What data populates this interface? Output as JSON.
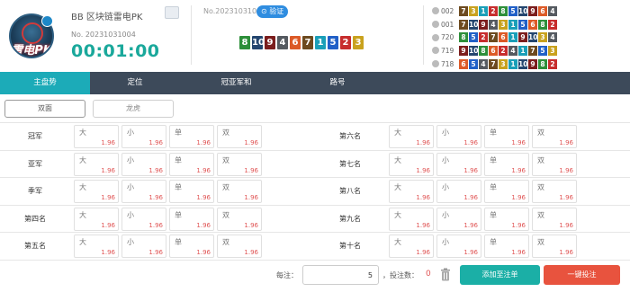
{
  "header": {
    "logo_text": "雷电PK",
    "game_title": "BB 区块链雷电PK",
    "current_issue": "No. 20231031004",
    "countdown": "00:01:00",
    "last_issue": "No.20231031003",
    "verify_label": "验证",
    "last_result": [
      {
        "n": "8",
        "c": "#2d8f3a"
      },
      {
        "n": "10",
        "c": "#24466f"
      },
      {
        "n": "9",
        "c": "#7b1d1d"
      },
      {
        "n": "4",
        "c": "#555a60"
      },
      {
        "n": "6",
        "c": "#dc5a27"
      },
      {
        "n": "7",
        "c": "#6d4a1f"
      },
      {
        "n": "1",
        "c": "#1a9fb8"
      },
      {
        "n": "5",
        "c": "#2160c7"
      },
      {
        "n": "2",
        "c": "#c72d2d"
      },
      {
        "n": "3",
        "c": "#c9a21e"
      }
    ]
  },
  "history": [
    {
      "no": "002",
      "balls": [
        "7",
        "3",
        "1",
        "2",
        "8",
        "5",
        "10",
        "9",
        "6",
        "4"
      ]
    },
    {
      "no": "001",
      "balls": [
        "7",
        "10",
        "9",
        "4",
        "3",
        "1",
        "5",
        "6",
        "8",
        "2"
      ]
    },
    {
      "no": "720",
      "balls": [
        "8",
        "5",
        "2",
        "7",
        "6",
        "1",
        "9",
        "10",
        "3",
        "4"
      ]
    },
    {
      "no": "719",
      "balls": [
        "9",
        "10",
        "8",
        "6",
        "2",
        "4",
        "1",
        "7",
        "5",
        "3"
      ]
    },
    {
      "no": "718",
      "balls": [
        "6",
        "5",
        "4",
        "7",
        "3",
        "1",
        "10",
        "9",
        "8",
        "2"
      ]
    }
  ],
  "ball_colors": {
    "1": "#1a9fb8",
    "2": "#c72d2d",
    "3": "#c9a21e",
    "4": "#555a60",
    "5": "#2160c7",
    "6": "#dc5a27",
    "7": "#6d4a1f",
    "8": "#2d8f3a",
    "9": "#7b1d1d",
    "10": "#24466f"
  },
  "tabs": [
    {
      "label": "主盘势",
      "active": true
    },
    {
      "label": "定位",
      "active": false
    },
    {
      "label": "冠亚军和",
      "active": false
    },
    {
      "label": "路号",
      "active": false
    }
  ],
  "subfilter": {
    "left": "双面",
    "right": "龙虎"
  },
  "left_ranks": [
    "冠军",
    "亚军",
    "季军",
    "第四名",
    "第五名"
  ],
  "right_ranks": [
    "第六名",
    "第七名",
    "第八名",
    "第九名",
    "第十名"
  ],
  "options": [
    {
      "label": "大",
      "odds": "1.96"
    },
    {
      "label": "小",
      "odds": "1.96"
    },
    {
      "label": "单",
      "odds": "1.96"
    },
    {
      "label": "双",
      "odds": "1.96"
    }
  ],
  "footer": {
    "per_bet_label": "每注：",
    "per_bet_value": "5",
    "bet_count_label": "，投注数：",
    "bet_count": "0",
    "add_button": "添加至注单",
    "bet_button": "一键投注"
  }
}
